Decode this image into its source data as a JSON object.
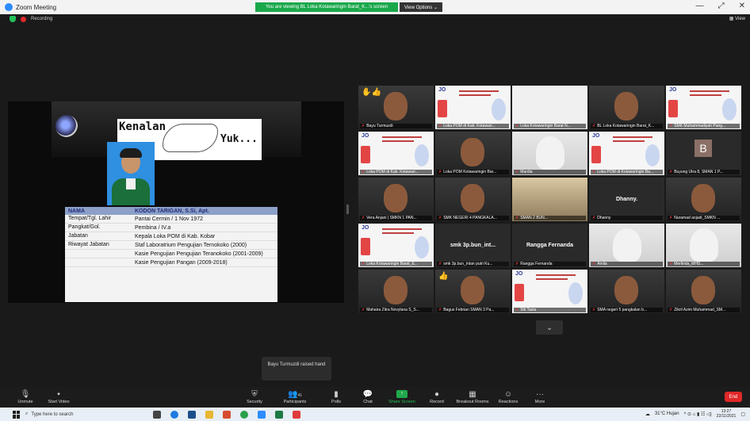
{
  "window": {
    "title": "Zoom Meeting",
    "view_banner": "You are viewing BL Loka Kotawaringin Barat_K...'s screen",
    "view_options": "View Options ⌄",
    "recording": "Recording",
    "view_label": "View"
  },
  "slide": {
    "kenalan": "Kenalan",
    "yuk": "Yuk...",
    "header": [
      "NAMA",
      "KODON TARIGAN, S.Si, Apt."
    ],
    "rows": [
      {
        "label": "Tempat/Tgl. Lahir",
        "value": "Pantai Cermin / 1 Nov 1972"
      },
      {
        "label": "Pangkat/Gol.",
        "value": "Pembina / IV.a"
      },
      {
        "label": "Jabatan",
        "value": "Kepala Loka POM di Kab. Kobar"
      },
      {
        "label": "Riwayat Jabatan",
        "value": "Staf Laboratrium Pengujian Ternokoko (2000)"
      },
      {
        "label": "",
        "value": "Kasie Pengujian  Pengujian Teranokoko (2001-2009)"
      },
      {
        "label": "",
        "value": "Kasie Pengujian Pangan (2009-2018)"
      }
    ]
  },
  "gallery": [
    {
      "name": "Bayu Turmuzdi",
      "kind": "face",
      "hands": "✋👍"
    },
    {
      "name": "Loka POM di Kab. Kotawari...",
      "kind": "poster"
    },
    {
      "name": "Loka Kotawaringin Barat N...",
      "kind": "blank"
    },
    {
      "name": "BL Loka Kotawaringin Barat_K...",
      "kind": "face",
      "active": true
    },
    {
      "name": "SMK Muhammadiyah Pang...",
      "kind": "poster"
    },
    {
      "name": "Loka POM di Kab. Kotawari...",
      "kind": "poster"
    },
    {
      "name": "Loka POM Kotawaringin Bar...",
      "kind": "face"
    },
    {
      "name": "Mardia",
      "kind": "hijab"
    },
    {
      "name": "Loka POM di Kotawaringin Ba...",
      "kind": "poster"
    },
    {
      "name": "Buyung  Utra 8, SMAN 1 P...",
      "kind": "avatar",
      "initial": "B"
    },
    {
      "name": "Vera Anjani | SMKN 1 PAN...",
      "kind": "face"
    },
    {
      "name": "SMK NEGERI 4 PANGKALA...",
      "kind": "face"
    },
    {
      "name": "SMAN 2 BUN...",
      "kind": "room"
    },
    {
      "name": "Dhanny",
      "kind": "text",
      "center": "Dhanny."
    },
    {
      "name": "Nuramad anjadi_SMKN ...",
      "kind": "face"
    },
    {
      "name": "Loka Kotawaringin Barat_E...",
      "kind": "poster"
    },
    {
      "name": "smk 3p.bun_intan putri Ku...",
      "kind": "text",
      "center": "smk 3p.bun_int..."
    },
    {
      "name": "Rangga Fernanda",
      "kind": "text",
      "center": "Rangga Fernanda"
    },
    {
      "name": "Amila",
      "kind": "hijab"
    },
    {
      "name": "Merlinda_MHS...",
      "kind": "hijab"
    },
    {
      "name": "Mahaira Zitra Novylana S_S...",
      "kind": "face"
    },
    {
      "name": "Bagus Febrian SMAN 3 Pa...",
      "kind": "face",
      "hands": "👍"
    },
    {
      "name": "Siti Tazia",
      "kind": "poster"
    },
    {
      "name": "SMA negeri 5 pangkalan b...",
      "kind": "face"
    },
    {
      "name": "Zikril Azim Muhammad_SM...",
      "kind": "face"
    }
  ],
  "toast": "Bayu Turmuzdi raised hand",
  "toolbar": {
    "unmute": "Unmute",
    "start_video": "Start Video",
    "security": "Security",
    "participants": "Participants",
    "participants_count": "41",
    "polls": "Polls",
    "chat": "Chat",
    "share_screen": "Share Screen",
    "record": "Record",
    "breakout": "Breakout Rooms",
    "reactions": "Reactions",
    "more": "More",
    "end": "End"
  },
  "taskbar": {
    "search_placeholder": "Type here to search",
    "weather": "31°C  Hujan",
    "time": "13:27",
    "date": "22/11/2021"
  }
}
